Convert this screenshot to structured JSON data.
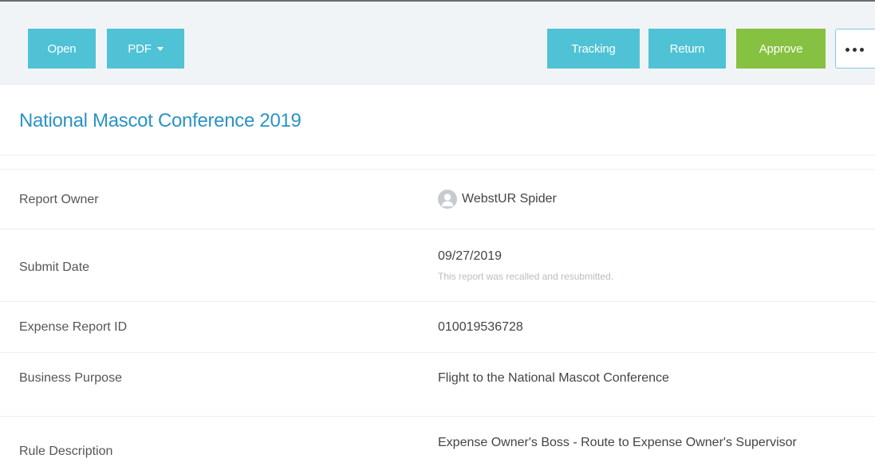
{
  "toolbar": {
    "open_label": "Open",
    "pdf_label": "PDF",
    "tracking_label": "Tracking",
    "return_label": "Return",
    "approve_label": "Approve",
    "colors": {
      "toolbar_bg": "#f1f4f7",
      "primary_button": "#4fc2d6",
      "approve_button": "#87c142"
    }
  },
  "report": {
    "title": "National Mascot Conference 2019",
    "title_color": "#2b93c6",
    "fields": {
      "owner": {
        "label": "Report Owner",
        "value": "WebstUR Spider",
        "icon": "user-avatar-icon"
      },
      "submit_date": {
        "label": "Submit Date",
        "value": "09/27/2019",
        "note": "This report was recalled and resubmitted."
      },
      "report_id": {
        "label": "Expense Report ID",
        "value": "010019536728"
      },
      "business_purpose": {
        "label": "Business Purpose",
        "value": "Flight to the National Mascot Conference"
      },
      "rule_description": {
        "label": "Rule Description",
        "value": "Expense Owner's Boss - Route to Expense Owner's Supervisor"
      }
    }
  }
}
